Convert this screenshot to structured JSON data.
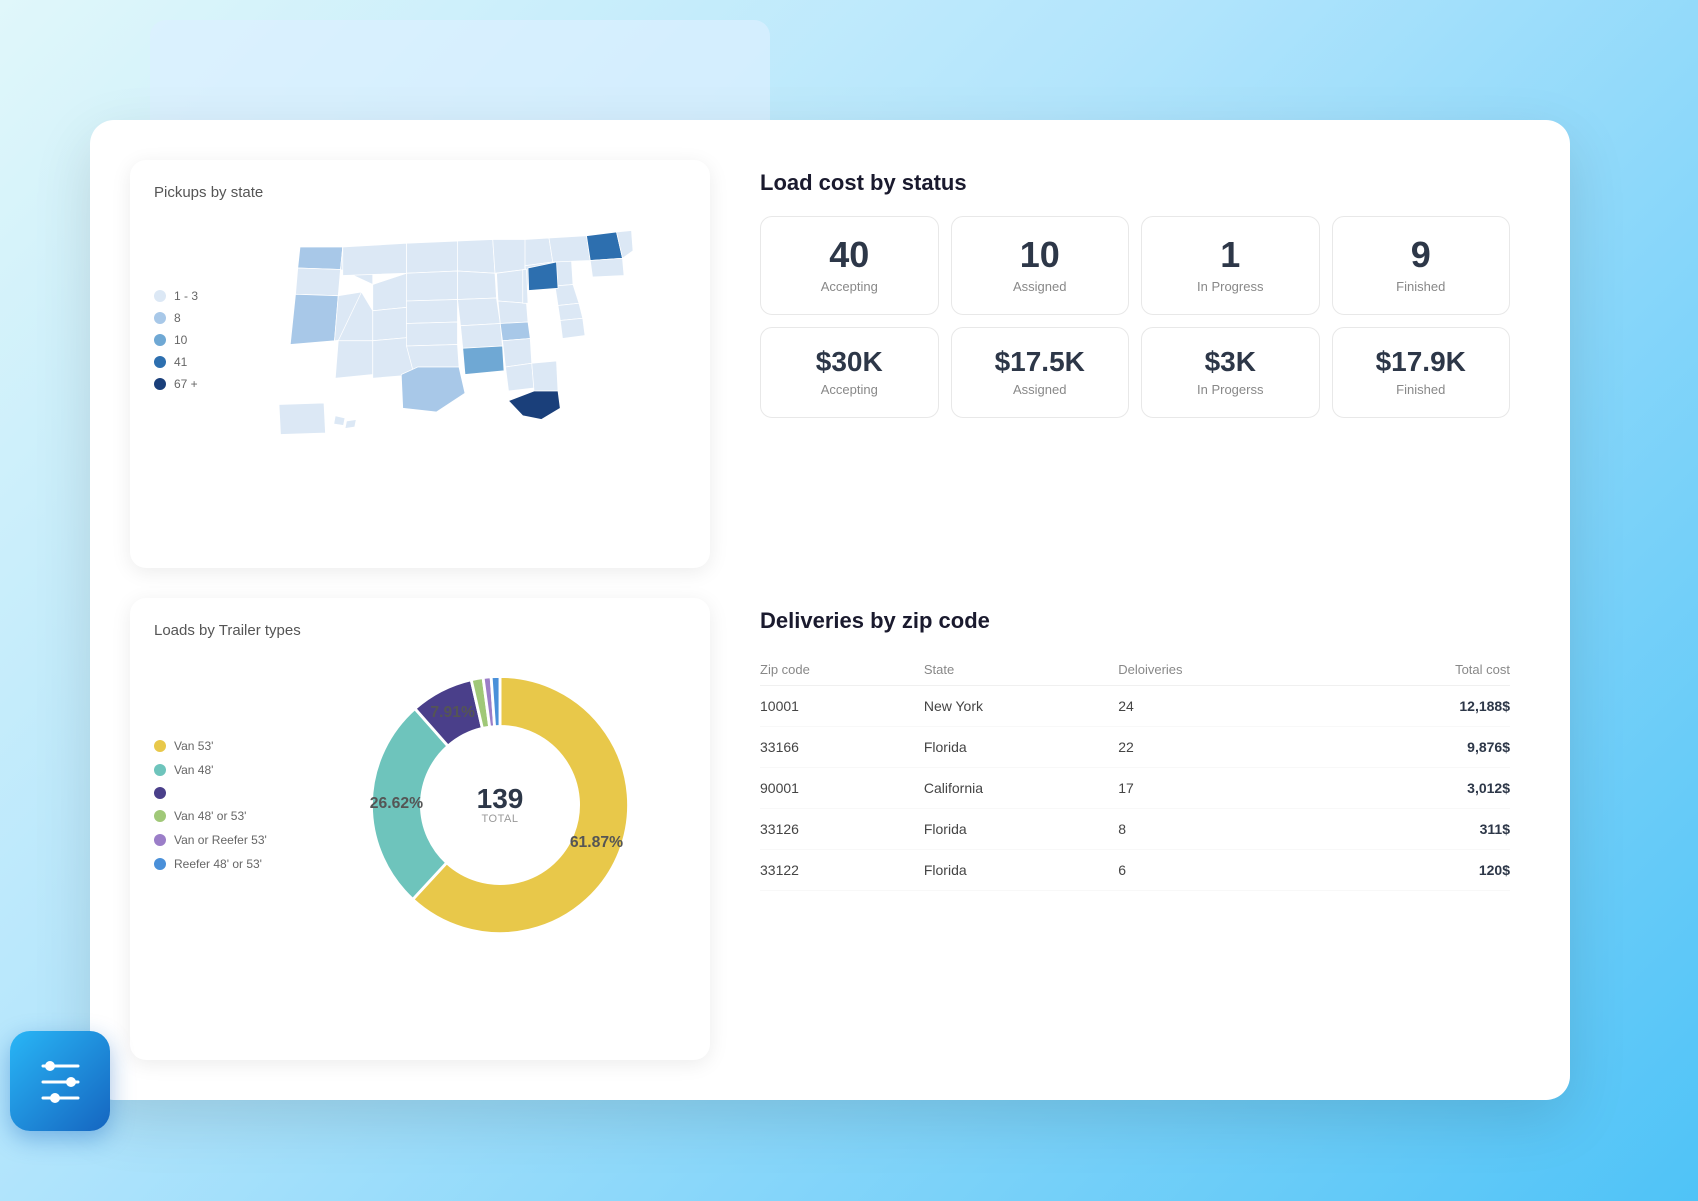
{
  "pickups": {
    "title": "Pickups by state",
    "legend": [
      {
        "label": "1 - 3",
        "color": "#dce8f5"
      },
      {
        "label": "8",
        "color": "#a8c8e8"
      },
      {
        "label": "10",
        "color": "#6fa8d4"
      },
      {
        "label": "41",
        "color": "#2d6faf"
      },
      {
        "label": "67 +",
        "color": "#1a3f7a"
      }
    ]
  },
  "loadCost": {
    "title": "Load cost by status",
    "counts": [
      {
        "value": "40",
        "label": "Accepting"
      },
      {
        "value": "10",
        "label": "Assigned"
      },
      {
        "value": "1",
        "label": "In Progress"
      },
      {
        "value": "9",
        "label": "Finished"
      }
    ],
    "costs": [
      {
        "value": "$30K",
        "label": "Accepting"
      },
      {
        "value": "$17.5K",
        "label": "Assigned"
      },
      {
        "value": "$3K",
        "label": "In Progerss"
      },
      {
        "value": "$17.9K",
        "label": "Finished"
      }
    ]
  },
  "trailerTypes": {
    "title": "Loads by Trailer types",
    "total": "139",
    "totalLabel": "TOTAL",
    "legend": [
      {
        "label": "Van 53'",
        "color": "#e8c84a"
      },
      {
        "label": "Van 48'",
        "color": "#6ec4bc"
      },
      {
        "label": "",
        "color": "#4a3f8a"
      },
      {
        "label": "Van 48' or 53'",
        "color": "#a0c878"
      },
      {
        "label": "Van or Reefer 53'",
        "color": "#9b7ec8"
      },
      {
        "label": "Reefer 48' or 53'",
        "color": "#4a90d9"
      }
    ],
    "segments": [
      {
        "percent": 61.87,
        "color": "#e8c84a",
        "label": "61.87%"
      },
      {
        "percent": 26.62,
        "color": "#6ec4bc",
        "label": "26.62%"
      },
      {
        "percent": 7.91,
        "color": "#4a3f8a",
        "label": "7.91%"
      },
      {
        "percent": 1.5,
        "color": "#a0c878",
        "label": ""
      },
      {
        "percent": 1.0,
        "color": "#9b7ec8",
        "label": ""
      },
      {
        "percent": 1.1,
        "color": "#4a90d9",
        "label": ""
      }
    ]
  },
  "deliveries": {
    "title": "Deliveries by zip code",
    "columns": [
      "Zip code",
      "State",
      "Deloiveries",
      "Total cost"
    ],
    "rows": [
      {
        "zip": "10001",
        "state": "New York",
        "count": "24",
        "cost": "12,188$"
      },
      {
        "zip": "33166",
        "state": "Florida",
        "count": "22",
        "cost": "9,876$"
      },
      {
        "zip": "90001",
        "state": "California",
        "count": "17",
        "cost": "3,012$"
      },
      {
        "zip": "33126",
        "state": "Florida",
        "count": "8",
        "cost": "311$"
      },
      {
        "zip": "33122",
        "state": "Florida",
        "count": "6",
        "cost": "120$"
      }
    ]
  }
}
